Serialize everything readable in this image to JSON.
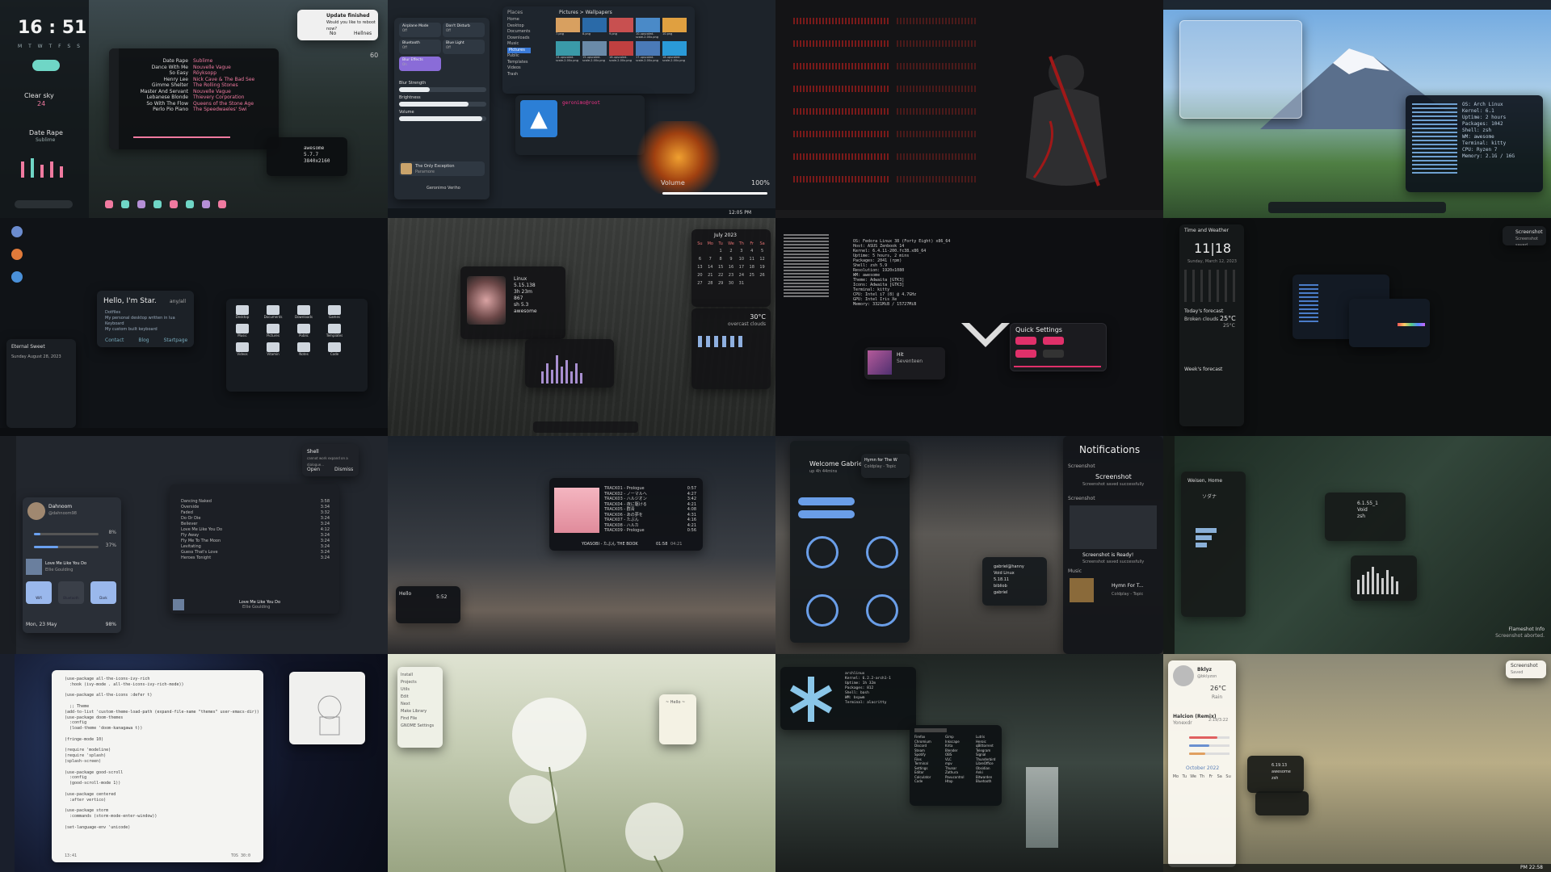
{
  "tile1": {
    "clock": "16 : 51",
    "weekdays": "M T W T F S S",
    "weather": "Clear sky",
    "temp": "24",
    "song_title": "Date Rape",
    "song_artist": "Sublime",
    "notification_title": "Update finished",
    "notification_body": "Would you like to reboot now?",
    "notif_no": "No",
    "notif_yes": "Hellnes",
    "volume_value": "60",
    "playlist": [
      {
        "title": "Date Rape",
        "artist": "Sublime"
      },
      {
        "title": "Dance With Me",
        "artist": "Nouvelle Vague"
      },
      {
        "title": "So Easy",
        "artist": "Röyksopp"
      },
      {
        "title": "Henry Lee",
        "artist": "Nick Cave & The Bad See"
      },
      {
        "title": "Gimme Shelter",
        "artist": "The Rolling Stones"
      },
      {
        "title": "Master And Servant",
        "artist": "Nouvelle Vague"
      },
      {
        "title": "Lebanese Blonde",
        "artist": "Thievery Corporation"
      },
      {
        "title": "So With The Flow",
        "artist": "Queens of the Stone Age"
      },
      {
        "title": "Perlo Pio Piano",
        "artist": "The Speedwaeles' Swi"
      }
    ],
    "fetch_lines": [
      "awesome",
      "5.7.7",
      "3840x2160"
    ]
  },
  "tile2": {
    "toggles": [
      {
        "label": "Airplane Mode",
        "state": "Off"
      },
      {
        "label": "Don't Disturb",
        "state": "Off"
      },
      {
        "label": "Bluetooth",
        "state": "Off"
      },
      {
        "label": "Blue Light",
        "state": "Off"
      },
      {
        "label": "Blur Effects",
        "state": "On"
      }
    ],
    "sliders": [
      {
        "label": "Blur Strength",
        "value": 0.35
      },
      {
        "label": "Brightness",
        "value": 0.8
      },
      {
        "label": "Volume",
        "value": 0.95
      }
    ],
    "places_title": "Places",
    "places": [
      "Home",
      "Desktop",
      "Documents",
      "Downloads",
      "Music",
      "Pictures",
      "Public",
      "Templates",
      "Videos",
      "Trash"
    ],
    "path": "Pictures > Wallpapers",
    "files": [
      "7.png",
      "8.png",
      "9.png",
      "10-upscaled-scale-2.00x.png",
      "10.png",
      "14-upscaled-scale-2.00x.png",
      "15-upscaled-scale-2.00x.png",
      "16-upscaled-scale-2.00x.png",
      "17-upscaled-scale-2.00x.png",
      "18-upscaled-scale-2.00x.png"
    ],
    "song": "The Only Exception",
    "artist": "Paramore",
    "volume_label": "Volume",
    "volume_pct": "100%",
    "user": "Geronimo Veriho",
    "time": "12:05 PM",
    "terminal_prompt": "geronimo@root"
  },
  "tile4": {
    "fetch_lines": [
      "OS: Arch Linux",
      "Kernel: 6.1",
      "Uptime: 2 hours",
      "Packages: 1042",
      "Shell: zsh",
      "WM: awesome",
      "Terminal: kitty",
      "CPU: Ryzen 7",
      "Memory: 2.1G / 16G"
    ]
  },
  "tile5": {
    "greeting": "Hello, I'm Star.",
    "greeting_sub": "any/all",
    "bullets": [
      "Dotfiles",
      "My personal desktop written in lua",
      "Keyboard",
      "My custom built keyboard"
    ],
    "links": [
      "Contact",
      "Blog",
      "Startpage"
    ],
    "date": "Sunday August 28, 2023",
    "folders": [
      "Desktop",
      "Documents",
      "Downloads",
      "Games",
      "Music",
      "Pictures",
      "Public",
      "Templates",
      "Videos",
      "Vitamin",
      "Notes",
      "Code"
    ],
    "sidebar_title": "Eternal Sweet"
  },
  "tile6": {
    "month": "July 2023",
    "weekdays": [
      "Su",
      "Mo",
      "Tu",
      "We",
      "Th",
      "Fr",
      "Sa"
    ],
    "days": [
      " ",
      " ",
      "1",
      "2",
      "3",
      "4",
      "5",
      "6",
      "7",
      "8",
      "9",
      "10",
      "11",
      "12",
      "13",
      "14",
      "15",
      "16",
      "17",
      "18",
      "19",
      "20",
      "21",
      "22",
      "23",
      "24",
      "25",
      "26",
      "27",
      "28",
      "29",
      "30",
      "31",
      " "
    ],
    "temp": "30°C",
    "condition": "overcast clouds",
    "fetch_lines": [
      "Linux",
      "5.15.138",
      "3h 23m",
      "867",
      "sh 5.3",
      "awesome"
    ]
  },
  "tile7": {
    "fetch_lines": [
      "OS: Fedora Linux 38 (Forty Eight) x86_64",
      "Host: ASUS Zenbook 14",
      "Kernel: 6.4.11-200.fc38.x86_64",
      "Uptime: 5 hours, 2 mins",
      "Packages: 2041 (rpm)",
      "Shell: zsh 5.9",
      "Resolution: 1920x1080",
      "WM: awesome",
      "Theme: Adwaita [GTK3]",
      "Icons: Adwaita [GTK3]",
      "Terminal: kitty",
      "CPU: Intel i7 (8) @ 4.7GHz",
      "GPU: Intel Iris Xe",
      "Memory: 3321MiB / 15727MiB"
    ],
    "quick_settings_title": "Quick Settings",
    "player_title": "Hit",
    "player_artist": "Seventeen"
  },
  "tile8": {
    "title": "Time and Weather",
    "clock_h": "11",
    "clock_m": "18",
    "date": "Sunday, March 12, 2023",
    "forecast_title": "Today's forecast",
    "today_cond": "Broken clouds",
    "today_temp": "25°C",
    "today_feels": "25°C",
    "week_title": "Week's forecast",
    "notif_title": "Screenshot",
    "notif_body": "Screenshot saved"
  },
  "tile9": {
    "profile_name": "Dahnoom",
    "profile_sub": "@dahnoom98",
    "volume_pct": "8%",
    "mic_pct": "37%",
    "song": "Love Me Like You Do",
    "artist": "Ellie Goulding",
    "toggles": [
      "Wifi",
      "Bluetooth",
      "Dark"
    ],
    "date": "Mon, 23 May",
    "battery": "98%",
    "notif_title": "Shell",
    "notif_body": "cannot work expand on a dialogue...",
    "notif_btns": [
      "Open",
      "Dismiss"
    ],
    "tracks": [
      {
        "t": "Dancing Naked",
        "d": "3:58"
      },
      {
        "t": "Overside",
        "d": "3:34"
      },
      {
        "t": "Faded",
        "d": "3:32"
      },
      {
        "t": "Do Or Die",
        "d": "3:24"
      },
      {
        "t": "Believer",
        "d": "3:24"
      },
      {
        "t": "Love Me Like You Do",
        "d": "4:12"
      },
      {
        "t": "Fly Away",
        "d": "3:24"
      },
      {
        "t": "Fly Me To The Moon",
        "d": "3:24"
      },
      {
        "t": "Levitating",
        "d": "3:24"
      },
      {
        "t": "Guess That's Love",
        "d": "3:24"
      },
      {
        "t": "Heroes Tonight",
        "d": "3:24"
      }
    ]
  },
  "tile10": {
    "tracks": [
      {
        "t": "TRACK01 - Prologue",
        "d": "0:57"
      },
      {
        "t": "TRACK02 - ノーマルへ",
        "d": "4:27"
      },
      {
        "t": "TRACK03 - ハルジオン",
        "d": "3:42"
      },
      {
        "t": "TRACK04 - 夜に駆ける",
        "d": "4:21"
      },
      {
        "t": "TRACK05 - 群青",
        "d": "4:08"
      },
      {
        "t": "TRACK06 - あの夢を",
        "d": "4:31"
      },
      {
        "t": "TRACK07 - たぶん",
        "d": "4:16"
      },
      {
        "t": "TRACK08 - ハルカ",
        "d": "4:21"
      },
      {
        "t": "TRACK09 - Prologue",
        "d": "0:56"
      }
    ],
    "now_playing": "YOASOBI - たぶん THE BOOK",
    "time": "01:58",
    "total": "04:21",
    "mini_title": "Hello",
    "mini_time": "5:52"
  },
  "tile11": {
    "welcome": "Welcome Gabriel",
    "welcome_sub": "up 4h 44mins",
    "song": "Hymn for The W",
    "artist": "Coldplay - Topic",
    "notifications_title": "Notifications",
    "notif1_app": "Screenshot",
    "notif1_title": "Screenshot",
    "notif1_body": "Screenshot saved successfully",
    "notif2_app": "Screenshot",
    "notif2_title": "Screenshot is Ready!",
    "notif2_body": "Screenshot saved successfully",
    "notif3_app": "Music",
    "notif3_title": "Hymn For T...",
    "notif3_body": "Coldplay - Topic",
    "fetch_lines": [
      "gabriel@hanny",
      "Void Linux",
      "5.18.11",
      "bibliob",
      "gabriel"
    ]
  },
  "tile12": {
    "location": "Weisen, Home",
    "weather_cond": "ソダナ",
    "fetch_lines": [
      "6.1.55_1",
      "Void",
      "zsh"
    ],
    "notif_title": "Flameshot Info",
    "notif_body": "Screenshot aborted."
  },
  "tile13": {
    "code_lines": [
      "(use-package all-the-icons-ivy-rich",
      "  :hook (ivy-mode . all-the-icons-ivy-rich-mode))",
      "",
      "(use-package all-the-icons :defer t)",
      "",
      "  ;; Theme",
      "(add-to-list 'custom-theme-load-path (expand-file-name \"themes\" user-emacs-dir))",
      "(use-package doom-themes",
      "  :config",
      "  (load-theme 'doom-kanagawa t))",
      "",
      "(fringe-mode 10)",
      "",
      "(require 'modeline)",
      "(require 'splash)",
      "(splash-screen)",
      "",
      "(use-package good-scroll",
      "  :config",
      "  (good-scroll-mode 1))",
      "",
      "(use-package centered",
      "  :after vertico)",
      "",
      "(use-package storm",
      "  :commands (storm-mode-enter-window))",
      "",
      "(set-language-env 'unicode)"
    ],
    "status_left": "13:41",
    "status_right": "TOS 30:0"
  },
  "tile14": {
    "sidebar_items": [
      "Install",
      "Projects",
      "Utils",
      "Edit",
      "Next",
      "Make Library",
      "Find File",
      "GNOME Settings"
    ],
    "note_title": "~ Hello ~"
  },
  "tile15": {
    "fetch_lines": [
      "archlinux",
      "Kernel: 6.2.2-arch1-1",
      "Uptime: 1h 32m",
      "Packages: 812",
      "Shell: bash",
      "WM: bspwm",
      "Terminal: alacritty"
    ],
    "apps_col1": [
      "Firefox",
      "Chromium",
      "Discord",
      "Steam",
      "Spotify",
      "Files",
      "Terminal",
      "Settings",
      "Editor",
      "Calculator",
      "Code"
    ],
    "apps_col2": [
      "Gimp",
      "Inkscape",
      "Krita",
      "Blender",
      "OBS",
      "VLC",
      "mpv",
      "Thunar",
      "Zathura",
      "Pavucontrol",
      "Htop"
    ],
    "apps_col3": [
      "Lutris",
      "Heroic",
      "qBittorrent",
      "Telegram",
      "Signal",
      "Thunderbird",
      "LibreOffice",
      "Obsidian",
      "Anki",
      "Bitwarden",
      "Bluetooth"
    ]
  },
  "tile16": {
    "profile_name": "Bklyz",
    "profile_handle": "@bklyzon",
    "temp": "26°C",
    "cond": "Rain",
    "song": "Halcion (Remix)",
    "artist": "Yonexdr",
    "song_time": "2:19/3:22",
    "month": "October 2022",
    "weekdays": [
      "Mo",
      "Tu",
      "We",
      "Th",
      "Fr",
      "Sa",
      "Su"
    ],
    "fetch_lines": [
      "6.19.13",
      "awesome",
      "zsh"
    ],
    "notif_title": "Screenshot",
    "notif_body": "Saved",
    "clock": "PM 22:58"
  }
}
